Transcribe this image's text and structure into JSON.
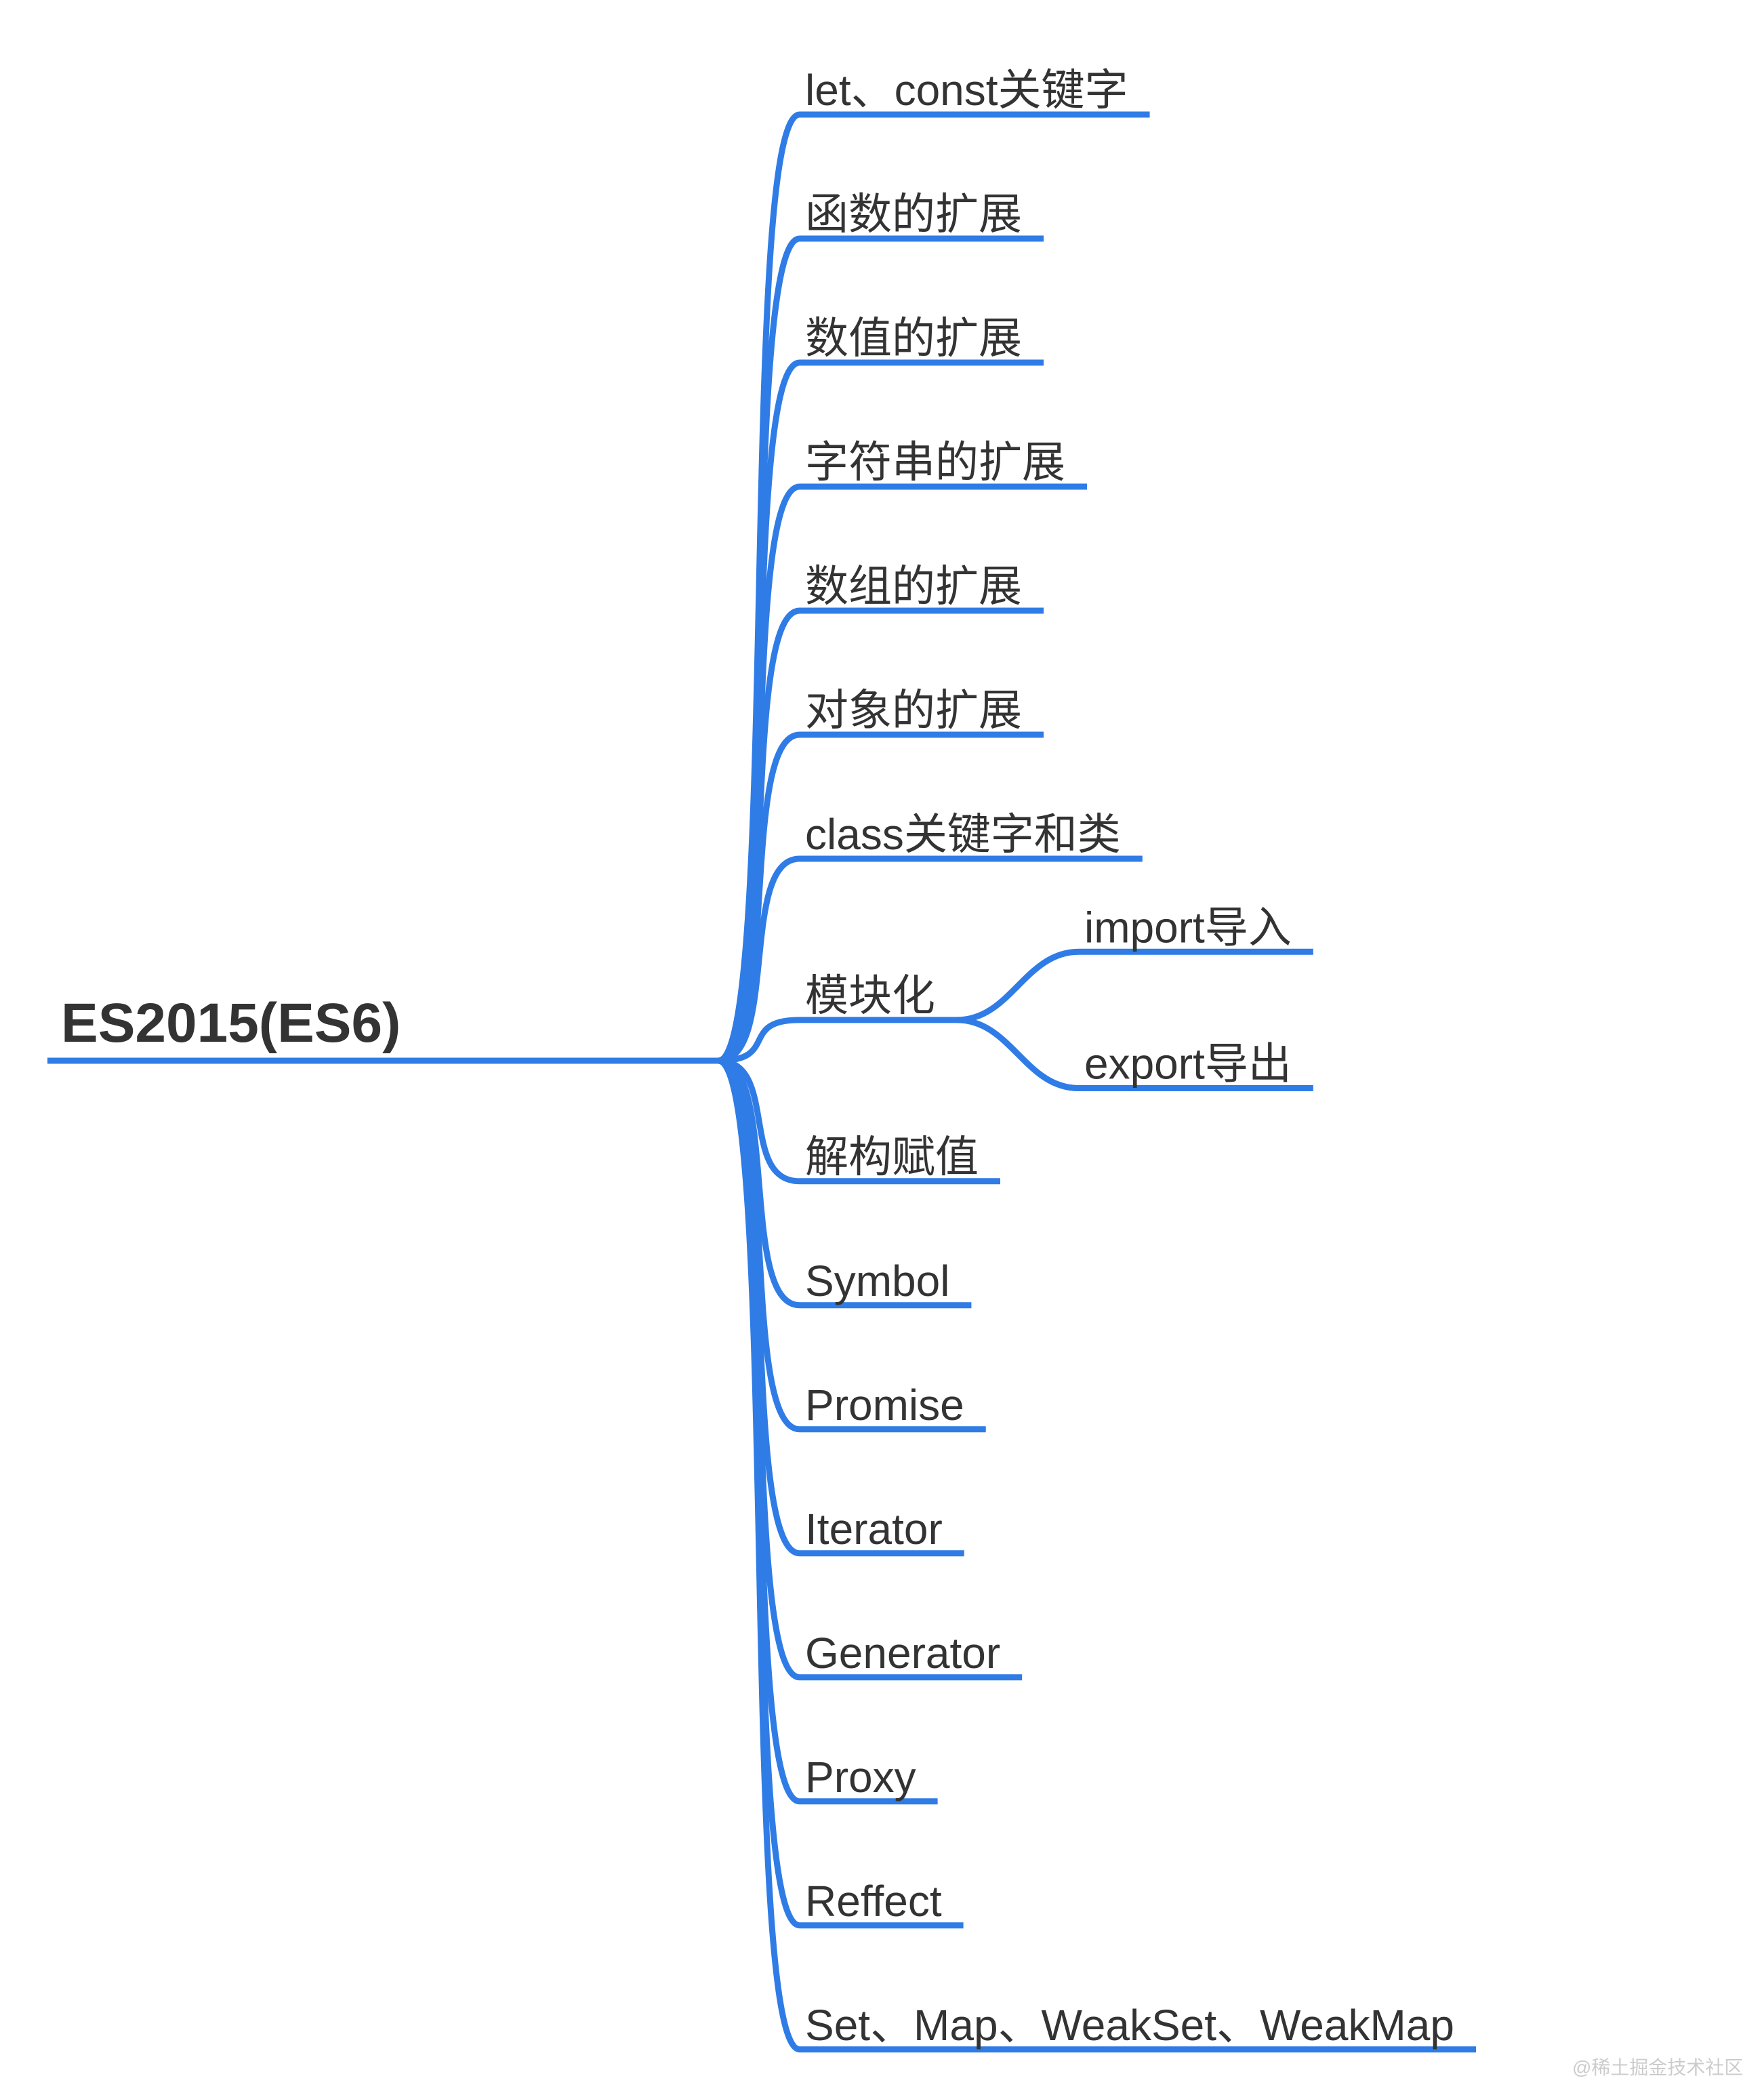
{
  "colors": {
    "branch": "#2f7ce6",
    "text": "#333333"
  },
  "root": {
    "label": "ES2015(ES6)"
  },
  "children": [
    {
      "label": "let、const关键字",
      "children": []
    },
    {
      "label": "函数的扩展",
      "children": []
    },
    {
      "label": "数值的扩展",
      "children": []
    },
    {
      "label": "字符串的扩展",
      "children": []
    },
    {
      "label": "数组的扩展",
      "children": []
    },
    {
      "label": "对象的扩展",
      "children": []
    },
    {
      "label": "class关键字和类",
      "children": []
    },
    {
      "label": "模块化",
      "children": [
        {
          "label": "import导入"
        },
        {
          "label": "export导出"
        }
      ]
    },
    {
      "label": "解构赋值",
      "children": []
    },
    {
      "label": "Symbol",
      "children": []
    },
    {
      "label": "Promise",
      "children": []
    },
    {
      "label": "Iterator",
      "children": []
    },
    {
      "label": "Generator",
      "children": []
    },
    {
      "label": "Proxy",
      "children": []
    },
    {
      "label": "Reffect",
      "children": []
    },
    {
      "label": "Set、Map、WeakSet、WeakMap",
      "children": []
    }
  ],
  "watermark": "@稀土掘金技术社区"
}
